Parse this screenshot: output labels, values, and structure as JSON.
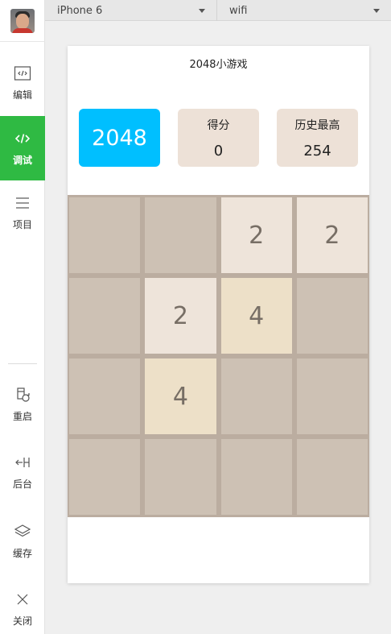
{
  "topbar": {
    "device": "iPhone 6",
    "network": "wifi"
  },
  "sidebar": {
    "items": [
      {
        "label": "编辑",
        "icon": "code-window-icon",
        "active": false
      },
      {
        "label": "调试",
        "icon": "code-brackets-icon",
        "active": true
      },
      {
        "label": "项目",
        "icon": "menu-lines-icon",
        "active": false
      },
      {
        "label": "重启",
        "icon": "restart-icon",
        "active": false
      },
      {
        "label": "后台",
        "icon": "background-icon",
        "active": false
      },
      {
        "label": "缓存",
        "icon": "layers-icon",
        "active": false
      },
      {
        "label": "关闭",
        "icon": "close-icon",
        "active": false
      }
    ]
  },
  "game": {
    "title": "2048小游戏",
    "logo": "2048",
    "score_label": "得分",
    "score_value": "0",
    "best_label": "历史最高",
    "best_value": "254",
    "board": [
      [
        "",
        "",
        "2",
        "2"
      ],
      [
        "",
        "2",
        "4",
        ""
      ],
      [
        "",
        "4",
        "",
        ""
      ],
      [
        "",
        "",
        "",
        ""
      ]
    ]
  },
  "colors": {
    "accent_green": "#2fba43",
    "logo_blue": "#00bfff",
    "board_bg": "#bbada0",
    "empty_cell": "#cdc1b4",
    "tile_2": "#eee4da",
    "tile_4": "#ede0c8",
    "score_box": "#ede1d7"
  }
}
